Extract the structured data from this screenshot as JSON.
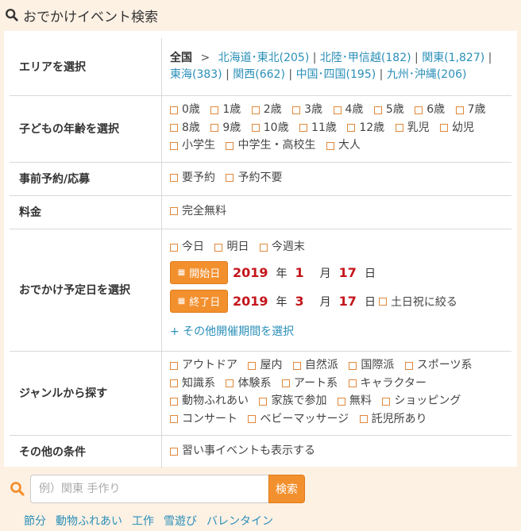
{
  "header": {
    "title": "おでかけイベント検索",
    "icon": "search-icon"
  },
  "area": {
    "label": "エリアを選択",
    "current": "全国",
    "arrow": ">",
    "regions": [
      "北海道･東北(205)",
      "北陸･甲信越(182)",
      "関東(1,827)",
      "東海(383)",
      "関西(662)",
      "中国･四国(195)",
      "九州･沖縄(206)"
    ],
    "separator": "|"
  },
  "age": {
    "label": "子どもの年齢を選択",
    "rows": [
      [
        "0歳",
        "1歳",
        "2歳",
        "3歳",
        "4歳",
        "5歳",
        "6歳",
        "7歳"
      ],
      [
        "8歳",
        "9歳",
        "10歳",
        "11歳",
        "12歳",
        "乳児",
        "幼児"
      ],
      [
        "小学生",
        "中学生・高校生",
        "大人"
      ]
    ]
  },
  "reservation": {
    "label": "事前予約/応募",
    "options": [
      "要予約",
      "予約不要"
    ]
  },
  "fee": {
    "label": "料金",
    "options": [
      "完全無料"
    ]
  },
  "date": {
    "label": "おでかけ予定日を選択",
    "quick": [
      "今日",
      "明日",
      "今週末"
    ],
    "start": {
      "button": "開始日",
      "year": "2019",
      "month": "1",
      "day": "17"
    },
    "end": {
      "button": "終了日",
      "year": "2019",
      "month": "3",
      "day": "17"
    },
    "units": {
      "year": "年",
      "month": "月",
      "day": "日"
    },
    "holiday_option": "土日祝に絞る",
    "more_link": "+ その他開催期間を選択"
  },
  "genre": {
    "label": "ジャンルから探す",
    "rows": [
      [
        "アウトドア",
        "屋内",
        "自然派",
        "国際派",
        "スポーツ系"
      ],
      [
        "知識系",
        "体験系",
        "アート系",
        "キャラクター"
      ],
      [
        "動物ふれあい",
        "家族で参加",
        "無料",
        "ショッピング"
      ],
      [
        "コンサート",
        "ベビーマッサージ",
        "託児所あり"
      ]
    ]
  },
  "other": {
    "label": "その他の条件",
    "options": [
      "習い事イベントも表示する"
    ]
  },
  "search": {
    "placeholder": "例）関東 手作り",
    "button": "検索"
  },
  "tags": [
    "節分",
    "動物ふれあい",
    "工作",
    "雪遊び",
    "バレンタイン"
  ],
  "colors": {
    "accent": "#f3902e",
    "link": "#2a8fb8",
    "date": "#c4161c",
    "bg": "#fdf1e4"
  }
}
